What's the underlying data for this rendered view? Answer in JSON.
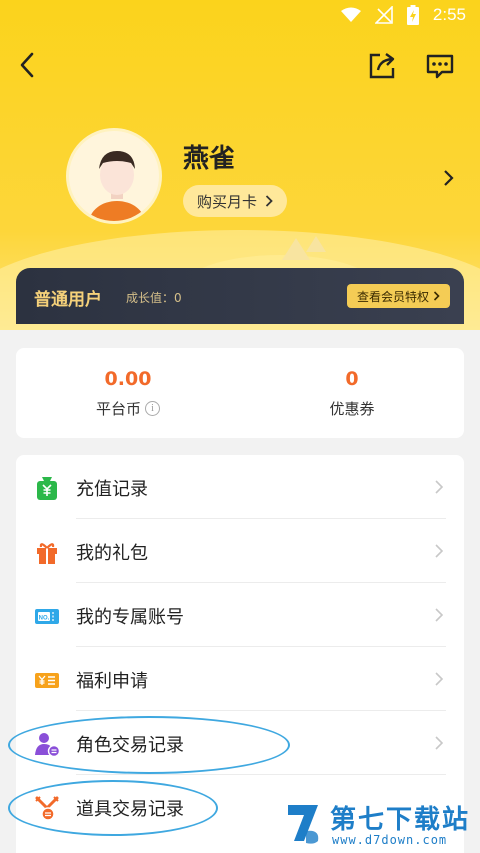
{
  "status_bar": {
    "time": "2:55",
    "icons": [
      "wifi-icon",
      "signal-off-icon",
      "battery-charging-icon"
    ]
  },
  "nav": {
    "back_icon": "back-arrow-icon",
    "share_icon": "share-icon",
    "message_icon": "message-icon"
  },
  "profile": {
    "name": "燕雀",
    "buy_card_label": "购买月卡"
  },
  "membership": {
    "level": "普通用户",
    "growth_label": "成长值：0",
    "privilege_button": "查看会员特权"
  },
  "wallet": {
    "coins_value": "0.00",
    "coins_label": "平台币",
    "coupons_value": "0",
    "coupons_label": "优惠券"
  },
  "menu": {
    "items": [
      {
        "label": "充值记录",
        "icon": "recharge-bag-icon"
      },
      {
        "label": "我的礼包",
        "icon": "gift-icon"
      },
      {
        "label": "我的专属账号",
        "icon": "account-ticket-icon"
      },
      {
        "label": "福利申请",
        "icon": "welfare-icon"
      },
      {
        "label": "角色交易记录",
        "icon": "role-trade-icon"
      },
      {
        "label": "道具交易记录",
        "icon": "item-trade-icon"
      }
    ]
  },
  "watermark": {
    "text": "第七下载站",
    "url": "www.d7down.com"
  },
  "colors": {
    "header": "#fbd31c",
    "accent": "#f26a2a",
    "member_bar": "#2c3240",
    "annotation": "#3fa8e0"
  }
}
